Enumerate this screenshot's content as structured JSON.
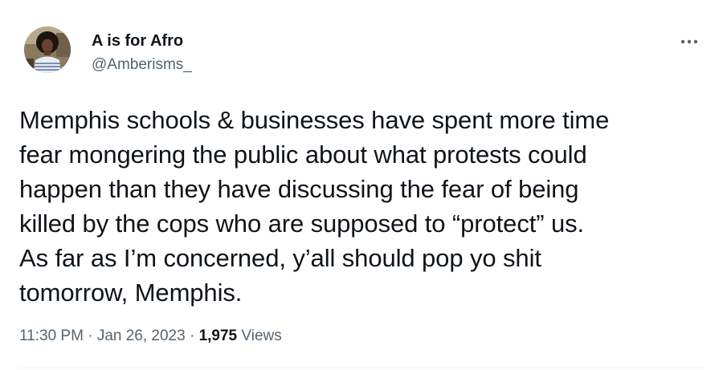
{
  "tweet": {
    "author": {
      "display_name": "A is for Afro",
      "handle": "@Amberisms_",
      "avatar_icon": "user-avatar-photo"
    },
    "more_icon": "more-horizontal-icon",
    "text": "Memphis schools & businesses have spent more time\nfear mongering the public about what protests could\nhappen than they have discussing the fear of being\nkilled by the cops who are supposed to “protect” us.\nAs far as I’m concerned, y’all should pop yo shit\ntomorrow, Memphis.",
    "meta": {
      "time": "11:30 PM",
      "separator": " · ",
      "date": "Jan 26, 2023",
      "views_count": "1,975",
      "views_label": " Views"
    }
  },
  "colors": {
    "text_primary": "#0f1419",
    "text_secondary": "#536471",
    "background": "#ffffff"
  }
}
